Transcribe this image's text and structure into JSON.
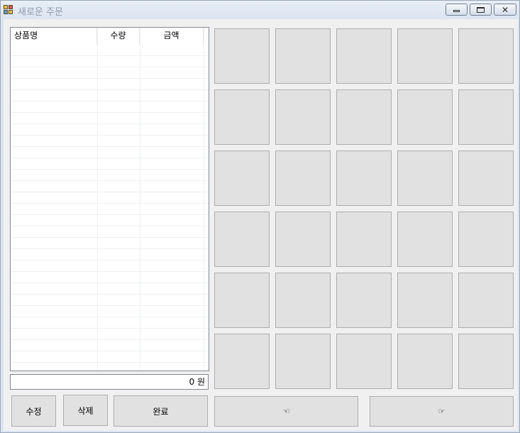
{
  "window": {
    "title": "새로운 주문"
  },
  "order_list": {
    "columns": [
      "상품명",
      "수량",
      "금액"
    ],
    "rows": []
  },
  "total": {
    "text": "0 원"
  },
  "buttons": {
    "edit": "수정",
    "delete": "삭제",
    "complete": "완료",
    "prev_page_icon": "hand-pointing-left-icon",
    "next_page_icon": "hand-pointing-right-icon"
  },
  "menu_grid": {
    "rows": 6,
    "cols": 5
  },
  "colors": {
    "form_background": "#f0f0f0",
    "button_face": "#e1e1e1",
    "button_border": "#adadad"
  }
}
